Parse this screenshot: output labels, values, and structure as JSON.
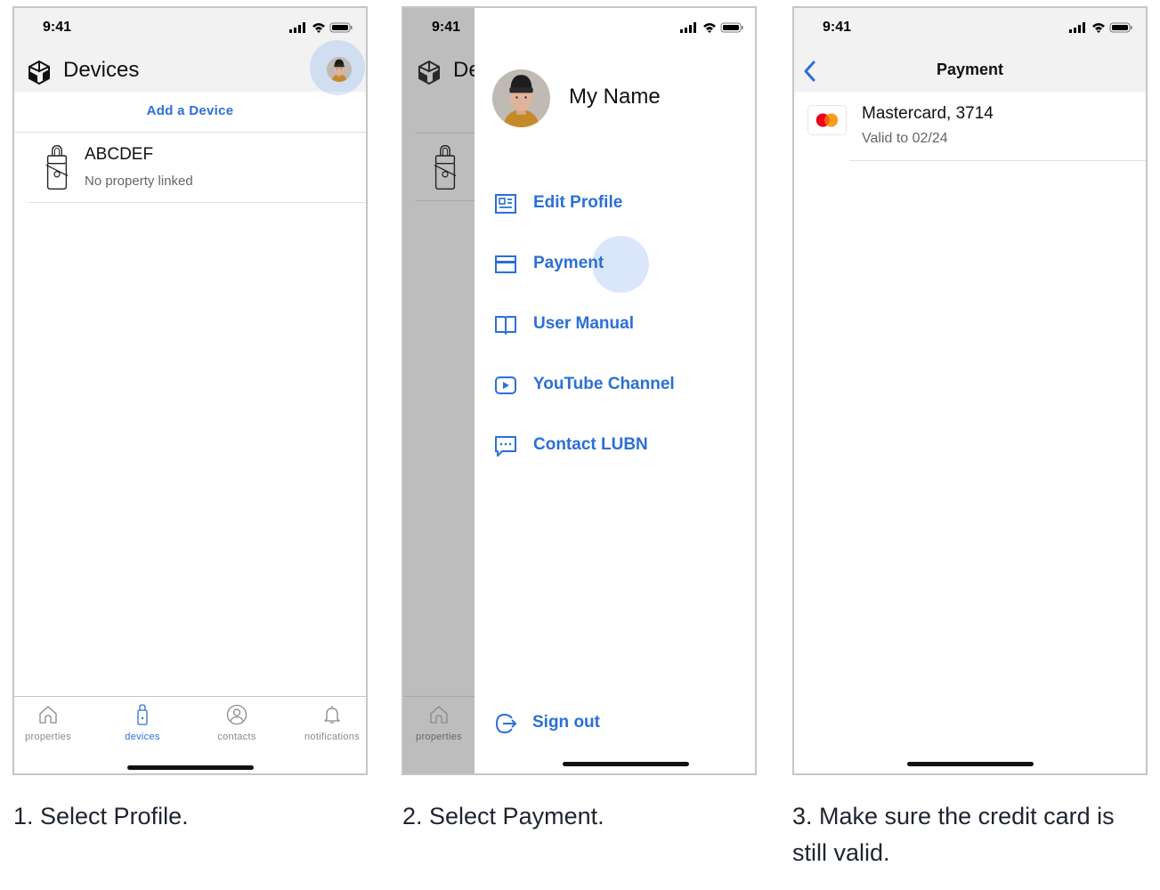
{
  "status_time": "9:41",
  "colors": {
    "accent": "#2b6fd8",
    "text": "#111111",
    "muted": "#666666",
    "border": "#c6c6c8",
    "shade": "#bdbdbd",
    "mastercard_red": "#eb001b",
    "mastercard_orange": "#f79e1b"
  },
  "screen1": {
    "title": "Devices",
    "add_device": "Add a Device",
    "device": {
      "name": "ABCDEF",
      "subtitle": "No property linked"
    },
    "tabs": [
      {
        "label": "properties",
        "icon": "home-icon"
      },
      {
        "label": "devices",
        "icon": "device-icon",
        "active": true
      },
      {
        "label": "contacts",
        "icon": "contact-icon"
      },
      {
        "label": "notifications",
        "icon": "bell-icon"
      }
    ],
    "caption": "1. Select Profile."
  },
  "screen2": {
    "background_title": "De",
    "background_tab": "properties",
    "profile_name": "My Name",
    "menu": [
      {
        "label": "Edit Profile",
        "icon": "id-card-icon"
      },
      {
        "label": "Payment",
        "icon": "credit-card-icon"
      },
      {
        "label": "User Manual",
        "icon": "book-icon"
      },
      {
        "label": "YouTube Channel",
        "icon": "play-icon"
      },
      {
        "label": "Contact LUBN",
        "icon": "chat-icon"
      }
    ],
    "sign_out": "Sign out",
    "caption": "2. Select Payment."
  },
  "screen3": {
    "title": "Payment",
    "card": {
      "name": "Mastercard, 3714",
      "valid": "Valid to 02/24",
      "brand_icon": "mastercard-icon"
    },
    "caption": "3. Make sure the credit card is still valid."
  }
}
